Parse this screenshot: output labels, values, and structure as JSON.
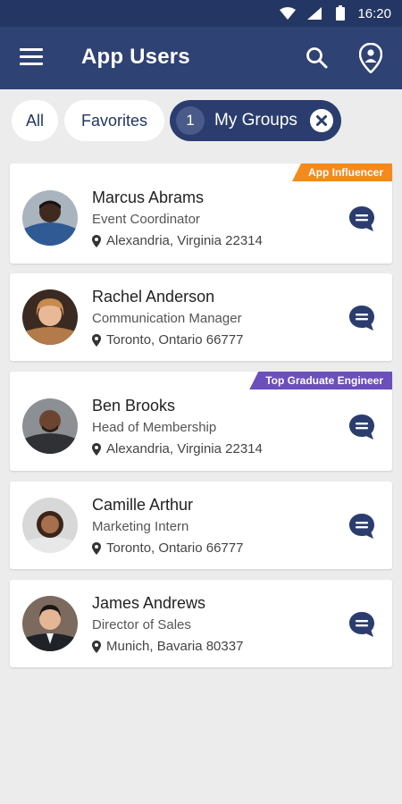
{
  "status_bar": {
    "time": "16:20",
    "icons": [
      "wifi-icon",
      "signal-icon",
      "battery-icon"
    ]
  },
  "app_bar": {
    "title": "App Users",
    "icons": [
      "menu-icon",
      "search-icon",
      "location-pin-icon"
    ]
  },
  "filters": {
    "all_label": "All",
    "favorites_label": "Favorites",
    "groups_count": "1",
    "groups_label": "My Groups"
  },
  "colors": {
    "primary": "#2e4274",
    "status_bar": "#243663",
    "influencer_badge": "#f28a1e",
    "engineer_badge": "#6b4fba",
    "background": "#ececec"
  },
  "users": [
    {
      "name": "Marcus Abrams",
      "role": "Event Coordinator",
      "location": "Alexandria, Virginia 22314",
      "badge": "App Influencer"
    },
    {
      "name": "Rachel Anderson",
      "role": "Communication Manager",
      "location": "Toronto, Ontario 66777"
    },
    {
      "name": "Ben Brooks",
      "role": "Head of Membership",
      "location": "Alexandria, Virginia 22314",
      "badge": "Top Graduate Engineer"
    },
    {
      "name": "Camille Arthur",
      "role": "Marketing Intern",
      "location": "Toronto, Ontario 66777"
    },
    {
      "name": "James Andrews",
      "role": "Director of Sales",
      "location": "Munich, Bavaria 80337"
    }
  ]
}
